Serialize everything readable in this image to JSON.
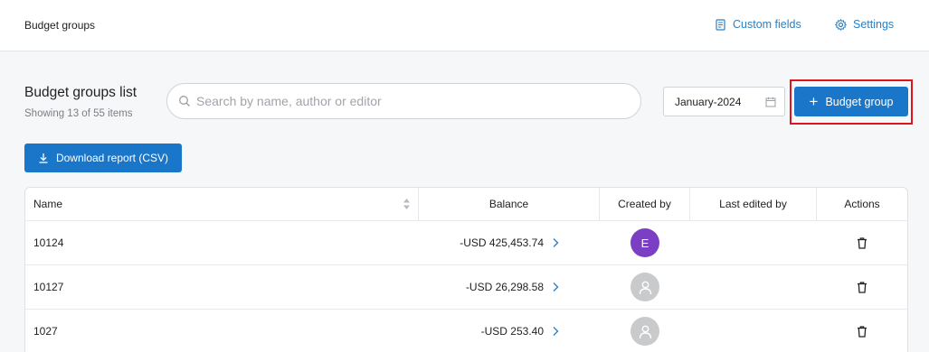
{
  "header": {
    "title": "Budget groups",
    "custom_fields_label": "Custom fields",
    "settings_label": "Settings"
  },
  "list": {
    "title": "Budget groups list",
    "subtitle": "Showing 13 of 55 items"
  },
  "search": {
    "placeholder": "Search by name, author or editor",
    "value": ""
  },
  "date_picker": {
    "value": "January-2024"
  },
  "add_button": {
    "label": "Budget group"
  },
  "download_button": {
    "label": "Download report (CSV)"
  },
  "table": {
    "columns": [
      "Name",
      "Balance",
      "Created by",
      "Last edited by",
      "Actions"
    ],
    "rows": [
      {
        "name": "10124",
        "balance": "-USD 425,453.74",
        "creator_initial": "E"
      },
      {
        "name": "10127",
        "balance": "-USD 26,298.58",
        "creator_initial": ""
      },
      {
        "name": "1027",
        "balance": "-USD 253.40",
        "creator_initial": ""
      }
    ]
  },
  "colors": {
    "primary": "#1976c9",
    "link": "#2f7fc1",
    "highlight": "#e0141e",
    "avatar_purple": "#7b3fc4",
    "avatar_gray": "#c9cacc"
  },
  "icons": [
    "document-icon",
    "gear-icon",
    "search-icon",
    "calendar-icon",
    "plus-icon",
    "download-icon",
    "sort-icon",
    "chevron-right-icon",
    "user-icon",
    "trash-icon"
  ]
}
